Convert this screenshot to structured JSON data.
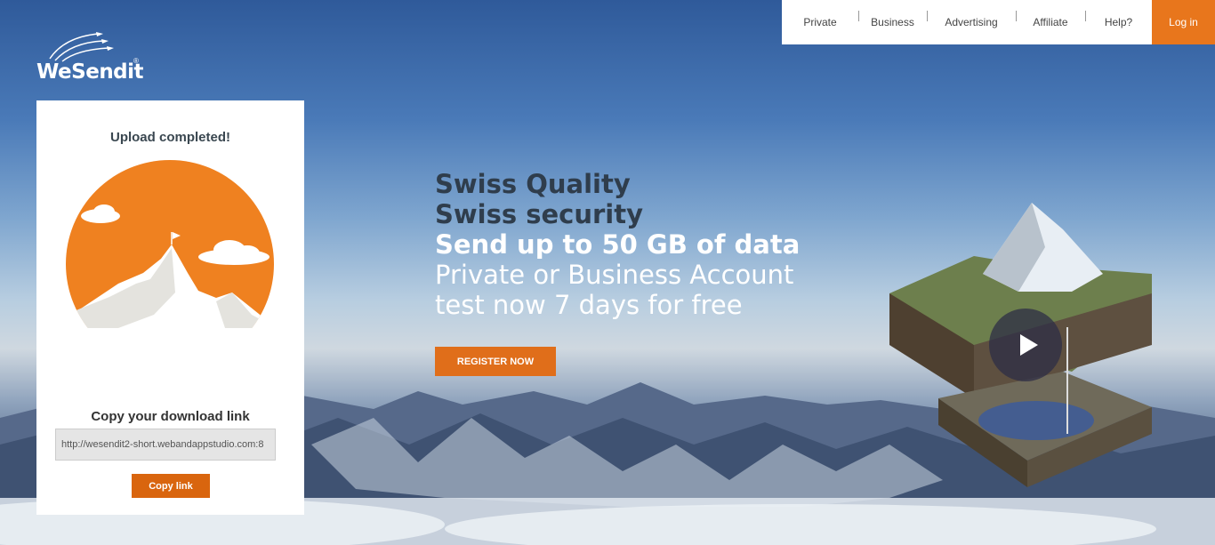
{
  "nav": {
    "items": [
      "Private",
      "Business",
      "Advertising",
      "Affiliate",
      "Help?"
    ],
    "login_label": "Log in"
  },
  "logo": {
    "text": "WeSendit",
    "registered": "®"
  },
  "card": {
    "upload_title": "Upload completed!",
    "copy_title": "Copy your download link",
    "link_value": "http://wesendit2-short.webandappstudio.com:8",
    "copy_button": "Copy link"
  },
  "hero": {
    "line1": "Swiss Quality",
    "line2": "Swiss security",
    "line3": "Send up to 50 GB of data",
    "line4": "Private or Business Account",
    "line5": "test now 7 days for free",
    "register_label": "REGISTER NOW"
  },
  "colors": {
    "accent": "#e8761c",
    "button": "#d9650e"
  },
  "icons": [
    "paper-plane-trails-icon",
    "play-icon"
  ]
}
